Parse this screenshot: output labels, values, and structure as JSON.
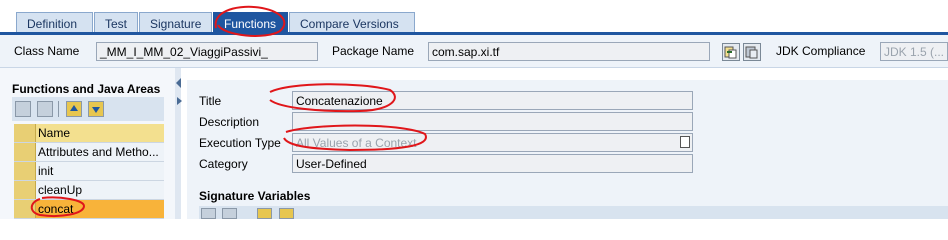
{
  "tabs": [
    {
      "label": "Definition",
      "active": false
    },
    {
      "label": "Test",
      "active": false
    },
    {
      "label": "Signature",
      "active": false
    },
    {
      "label": "Functions",
      "active": true
    },
    {
      "label": "Compare Versions",
      "active": false
    }
  ],
  "header": {
    "class_name_label": "Class Name",
    "class_name_value": "_MM_I_MM_02_ViaggiPassivi_",
    "package_name_label": "Package Name",
    "package_name_value": "com.sap.xi.tf",
    "jdk_label": "JDK Compliance",
    "jdk_value": "JDK 1.5 (..."
  },
  "left_panel": {
    "title": "Functions and Java Areas",
    "column_header": "Name",
    "items": [
      {
        "label": "Attributes and Metho...",
        "selected": false
      },
      {
        "label": "init",
        "selected": false
      },
      {
        "label": "cleanUp",
        "selected": false
      },
      {
        "label": "concat",
        "selected": true
      }
    ]
  },
  "form": {
    "title_label": "Title",
    "title_value": "Concatenazione",
    "description_label": "Description",
    "description_value": "",
    "execution_type_label": "Execution Type",
    "execution_type_value": "All Values of a Context",
    "category_label": "Category",
    "category_value": "User-Defined",
    "signature_variables_label": "Signature Variables"
  },
  "colors": {
    "tab_active": "#1f56a0",
    "tab_inactive": "#d5e2f1",
    "selected_row": "#f8b33a",
    "annotation": "#e0161a"
  }
}
